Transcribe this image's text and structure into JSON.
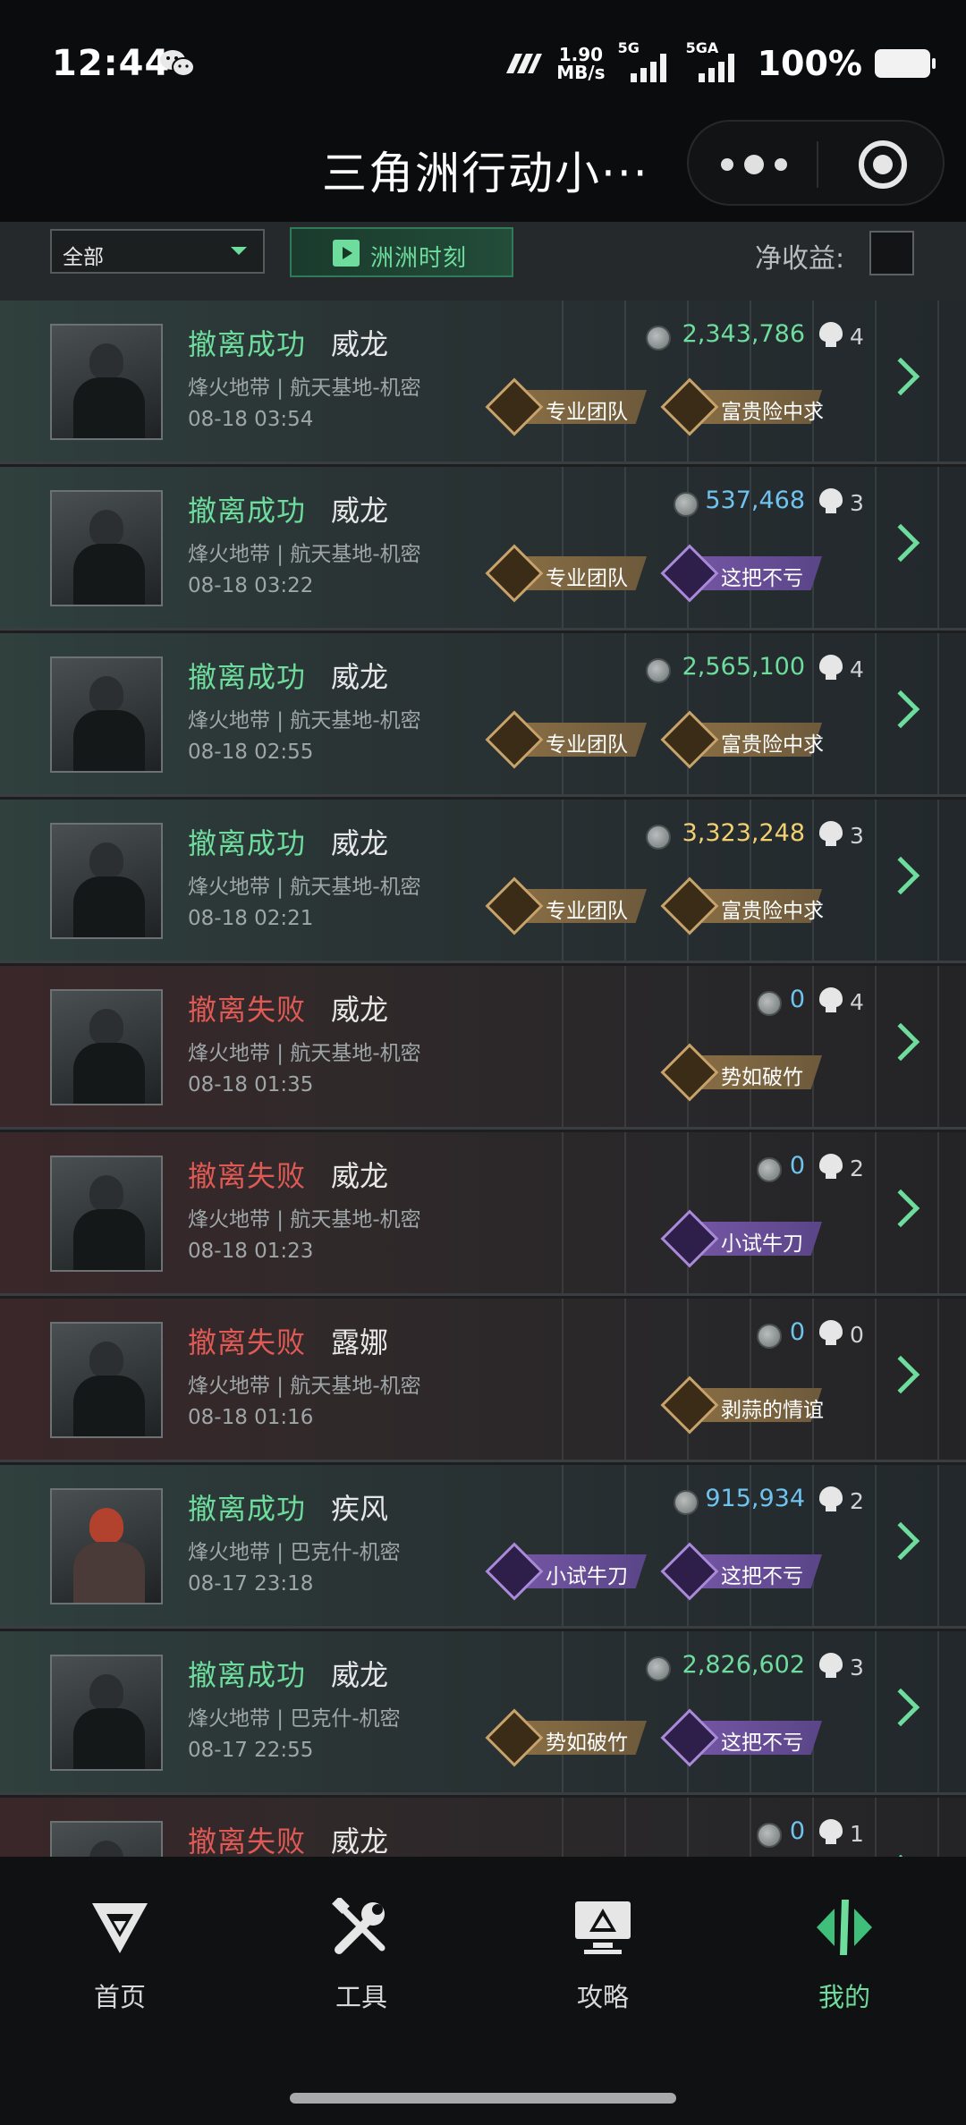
{
  "status_bar": {
    "time": "12:44",
    "speed_value": "1.90",
    "speed_unit": "MB/s",
    "net1": "5G",
    "net2": "5GA",
    "battery": "100%"
  },
  "header": {
    "title": "三角洲行动小···"
  },
  "filter": {
    "selected": "全部",
    "moments_label": "洲洲时刻",
    "net_label": "净收益:"
  },
  "icons": {
    "coin": "coin-icon",
    "skull": "skull-icon",
    "chevron": "chevron-right-icon"
  },
  "colors": {
    "accent_green": "#6ddc9c",
    "fail_red": "#e05a55",
    "value_blue": "#6fc3ee",
    "value_gold": "#f2d070"
  },
  "matches": [
    {
      "result": "撤离成功",
      "status": "win",
      "operator": "威龙",
      "map": "烽火地带 | 航天基地-机密",
      "time": "08-18 03:54",
      "value": "2,343,786",
      "value_color": "#6ddc9c",
      "kills": "4",
      "avatar": "weilong",
      "badges": [
        {
          "label": "专业团队",
          "type": "gold"
        },
        {
          "label": "富贵险中求",
          "type": "gold"
        }
      ]
    },
    {
      "result": "撤离成功",
      "status": "win",
      "operator": "威龙",
      "map": "烽火地带 | 航天基地-机密",
      "time": "08-18 03:22",
      "value": "537,468",
      "value_color": "#6fc3ee",
      "kills": "3",
      "avatar": "weilong",
      "badges": [
        {
          "label": "专业团队",
          "type": "gold"
        },
        {
          "label": "这把不亏",
          "type": "purple"
        }
      ]
    },
    {
      "result": "撤离成功",
      "status": "win",
      "operator": "威龙",
      "map": "烽火地带 | 航天基地-机密",
      "time": "08-18 02:55",
      "value": "2,565,100",
      "value_color": "#6ddc9c",
      "kills": "4",
      "avatar": "weilong",
      "badges": [
        {
          "label": "专业团队",
          "type": "gold"
        },
        {
          "label": "富贵险中求",
          "type": "gold"
        }
      ]
    },
    {
      "result": "撤离成功",
      "status": "win",
      "operator": "威龙",
      "map": "烽火地带 | 航天基地-机密",
      "time": "08-18 02:21",
      "value": "3,323,248",
      "value_color": "#f2d070",
      "kills": "3",
      "avatar": "weilong",
      "badges": [
        {
          "label": "专业团队",
          "type": "gold"
        },
        {
          "label": "富贵险中求",
          "type": "gold"
        }
      ]
    },
    {
      "result": "撤离失败",
      "status": "lose",
      "operator": "威龙",
      "map": "烽火地带 | 航天基地-机密",
      "time": "08-18 01:35",
      "value": "0",
      "value_color": "#6fc3ee",
      "kills": "4",
      "avatar": "weilong",
      "badges": [
        {
          "label": "势如破竹",
          "type": "gold"
        }
      ]
    },
    {
      "result": "撤离失败",
      "status": "lose",
      "operator": "威龙",
      "map": "烽火地带 | 航天基地-机密",
      "time": "08-18 01:23",
      "value": "0",
      "value_color": "#6fc3ee",
      "kills": "2",
      "avatar": "weilong",
      "badges": [
        {
          "label": "小试牛刀",
          "type": "purple"
        }
      ]
    },
    {
      "result": "撤离失败",
      "status": "lose",
      "operator": "露娜",
      "map": "烽火地带 | 航天基地-机密",
      "time": "08-18 01:16",
      "value": "0",
      "value_color": "#6fc3ee",
      "kills": "0",
      "avatar": "luna",
      "badges": [
        {
          "label": "剥蒜的情谊",
          "type": "gold"
        }
      ]
    },
    {
      "result": "撤离成功",
      "status": "win",
      "operator": "疾风",
      "map": "烽火地带 | 巴克什-机密",
      "time": "08-17 23:18",
      "value": "915,934",
      "value_color": "#6fc3ee",
      "kills": "2",
      "avatar": "jifeng",
      "badges": [
        {
          "label": "小试牛刀",
          "type": "purple"
        },
        {
          "label": "这把不亏",
          "type": "purple"
        }
      ]
    },
    {
      "result": "撤离成功",
      "status": "win",
      "operator": "威龙",
      "map": "烽火地带 | 巴克什-机密",
      "time": "08-17 22:55",
      "value": "2,826,602",
      "value_color": "#6ddc9c",
      "kills": "3",
      "avatar": "weilong",
      "badges": [
        {
          "label": "势如破竹",
          "type": "gold"
        },
        {
          "label": "这把不亏",
          "type": "purple"
        }
      ]
    },
    {
      "result": "撤离失败",
      "status": "lose",
      "operator": "威龙",
      "map": "",
      "time": "",
      "value": "0",
      "value_color": "#6fc3ee",
      "kills": "1",
      "avatar": "weilong",
      "badges": []
    }
  ],
  "bottom_nav": [
    {
      "label": "首页",
      "icon": "home-logo-icon",
      "active": false
    },
    {
      "label": "工具",
      "icon": "tools-icon",
      "active": false
    },
    {
      "label": "攻略",
      "icon": "guide-monitor-icon",
      "active": false
    },
    {
      "label": "我的",
      "icon": "profile-logo-icon",
      "active": true
    }
  ]
}
